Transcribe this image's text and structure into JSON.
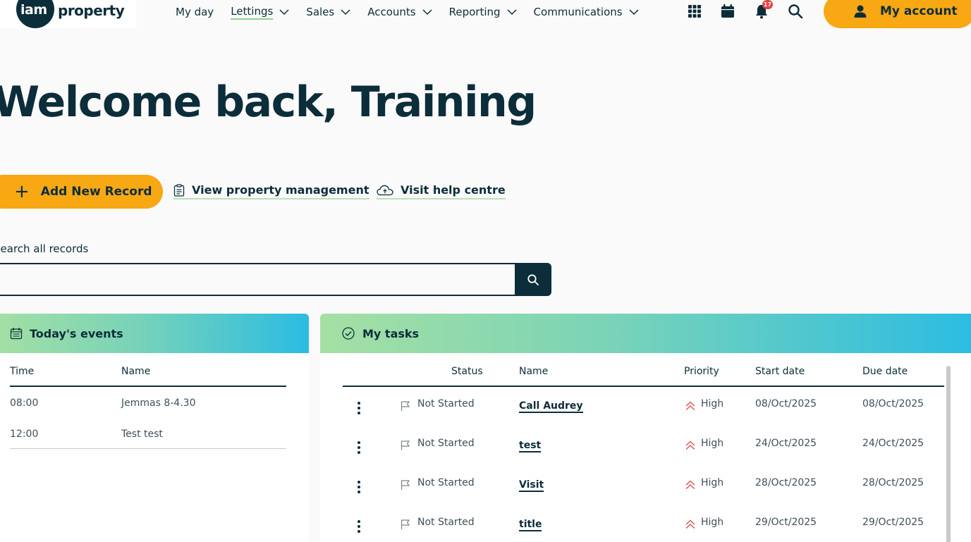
{
  "logo": {
    "part1": "iam",
    "part2": "property"
  },
  "nav": {
    "items": [
      {
        "label": "My day",
        "dropdown": false,
        "active": false
      },
      {
        "label": "Lettings",
        "dropdown": true,
        "active": true
      },
      {
        "label": "Sales",
        "dropdown": true,
        "active": false
      },
      {
        "label": "Accounts",
        "dropdown": true,
        "active": false
      },
      {
        "label": "Reporting",
        "dropdown": true,
        "active": false
      },
      {
        "label": "Communications",
        "dropdown": true,
        "active": false
      }
    ],
    "notifications_count": "17",
    "account_label": "My account"
  },
  "welcome": {
    "title": "Welcome back, Training"
  },
  "actions": {
    "add_label": "Add New Record",
    "property_mgmt_label": "View property management",
    "help_label": "Visit help centre"
  },
  "search": {
    "label": "Search all records",
    "value": "",
    "placeholder": ""
  },
  "events": {
    "title": "Today's events",
    "columns": [
      "Time",
      "Name"
    ],
    "rows": [
      {
        "time": "08:00",
        "name": "Jemmas 8-4.30"
      },
      {
        "time": "12:00",
        "name": "Test test"
      }
    ]
  },
  "tasks": {
    "title": "My tasks",
    "columns": [
      "Status",
      "Name",
      "Priority",
      "Start date",
      "Due date"
    ],
    "rows": [
      {
        "status": "Not Started",
        "name": "Call Audrey",
        "priority": "High",
        "start": "08/Oct/2025",
        "due": "08/Oct/2025"
      },
      {
        "status": "Not Started",
        "name": "test",
        "priority": "High",
        "start": "24/Oct/2025",
        "due": "24/Oct/2025"
      },
      {
        "status": "Not Started",
        "name": "Visit",
        "priority": "High",
        "start": "28/Oct/2025",
        "due": "28/Oct/2025"
      },
      {
        "status": "Not Started",
        "name": "title",
        "priority": "High",
        "start": "29/Oct/2025",
        "due": "29/Oct/2025"
      }
    ]
  },
  "colors": {
    "navy": "#0c2d3a",
    "accent": "#f7a813",
    "badge": "#e8413f",
    "priority_high": "#e05252",
    "gradient_start": "#a5e0a3",
    "gradient_end": "#2bbce3"
  },
  "icons": {
    "apps": "grid-icon",
    "calendar": "calendar-icon",
    "notifications": "bell-icon",
    "search": "search-icon",
    "account": "user-icon",
    "add": "plus-icon",
    "property_mgmt": "clipboard-icon",
    "help": "cloud-icon",
    "events": "calendar-outline-icon",
    "tasks": "check-circle-icon",
    "row_menu": "kebab-icon",
    "status": "flag-icon",
    "priority": "double-chevron-up-icon"
  }
}
